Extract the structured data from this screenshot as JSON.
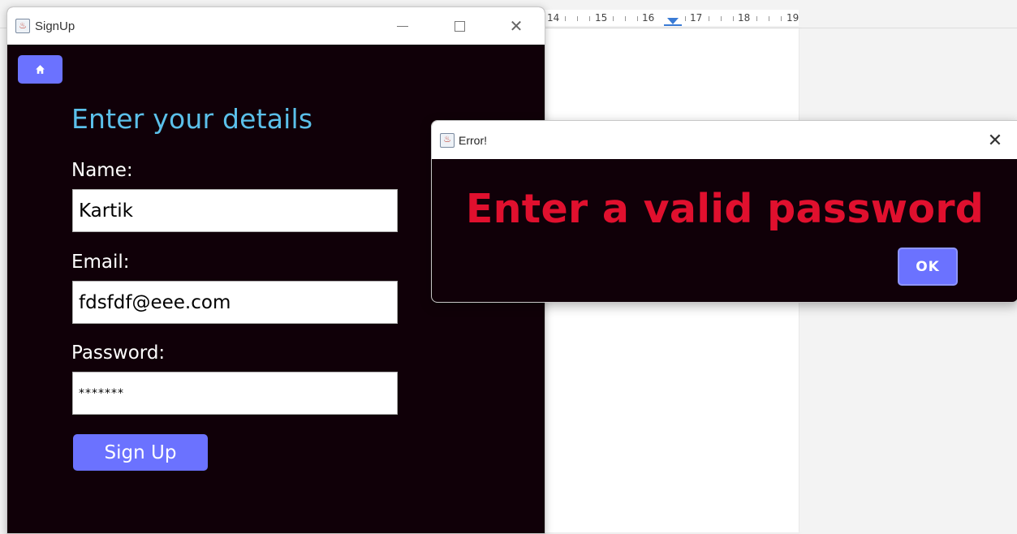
{
  "background_app": {
    "ruler_numbers": [
      "14",
      "15",
      "16",
      "17",
      "18",
      "19"
    ]
  },
  "signup_window": {
    "title": "SignUp",
    "home_icon": "home-icon",
    "heading": "Enter your details",
    "name_label": "Name:",
    "name_value": "Kartik",
    "email_label": "Email:",
    "email_value": "fdsfdf@eee.com",
    "password_label": "Password:",
    "password_value": "*******",
    "signup_button": "Sign Up",
    "controls": {
      "minimize": "minimize-icon",
      "maximize": "maximize-icon",
      "close": "close-icon"
    }
  },
  "error_dialog": {
    "title": "Error!",
    "message": "Enter a valid password",
    "ok_button": "OK",
    "close": "close-icon"
  },
  "colors": {
    "window_bg": "#100008",
    "accent_button": "#6b72ff",
    "heading": "#5bc0ea",
    "error_text": "#e0102e"
  }
}
